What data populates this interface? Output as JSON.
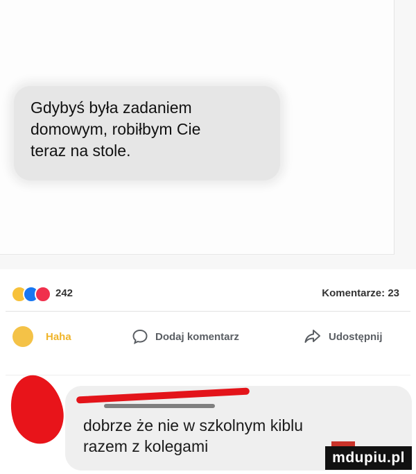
{
  "post": {
    "message": [
      "Gdybyś była zadaniem",
      "domowym, robiłbym Cie",
      "teraz na stole."
    ]
  },
  "reactions": {
    "icons": [
      "haha-emoji-icon",
      "like-icon",
      "love-icon"
    ],
    "count": "242",
    "comments_label": "Komentarze: 23"
  },
  "actions": {
    "haha_label": "Haha",
    "comment_label": "Dodaj komentarz",
    "share_label": "Udostępnij"
  },
  "comment": {
    "text": [
      "dobrze że nie w szkolnym kiblu",
      "razem z kolegami"
    ]
  },
  "watermark": "mdupiu.pl",
  "colors": {
    "accent_blue": "#1877f2",
    "love_red": "#f0304d",
    "haha_yellow": "#f7c13a",
    "redaction_red": "#e3141a"
  }
}
